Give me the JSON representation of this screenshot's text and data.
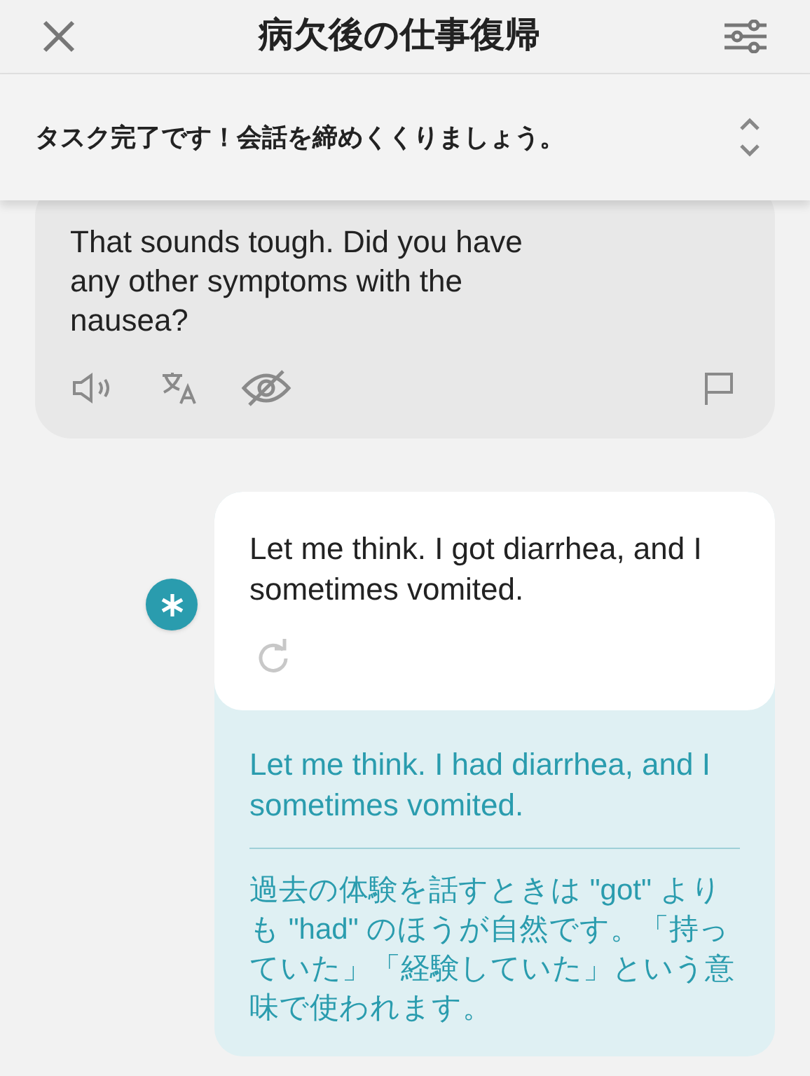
{
  "header": {
    "title": "病欠後の仕事復帰"
  },
  "task_banner": {
    "text": "タスク完了です！会話を締めくくりましょう。"
  },
  "messages": [
    {
      "kind": "partner",
      "text": "That sounds tough. Did you have any other symptoms with the nausea?"
    },
    {
      "kind": "user",
      "text": "Let me think. I got diarrhea, and I sometimes vomited.",
      "correction": "Let me think. I had diarrhea, and I sometimes vomited.",
      "explanation": "過去の体験を話すときは \"got\" よりも \"had\" のほうが自然です。「持っていた」「経験していた」という意味で使われます。"
    }
  ]
}
